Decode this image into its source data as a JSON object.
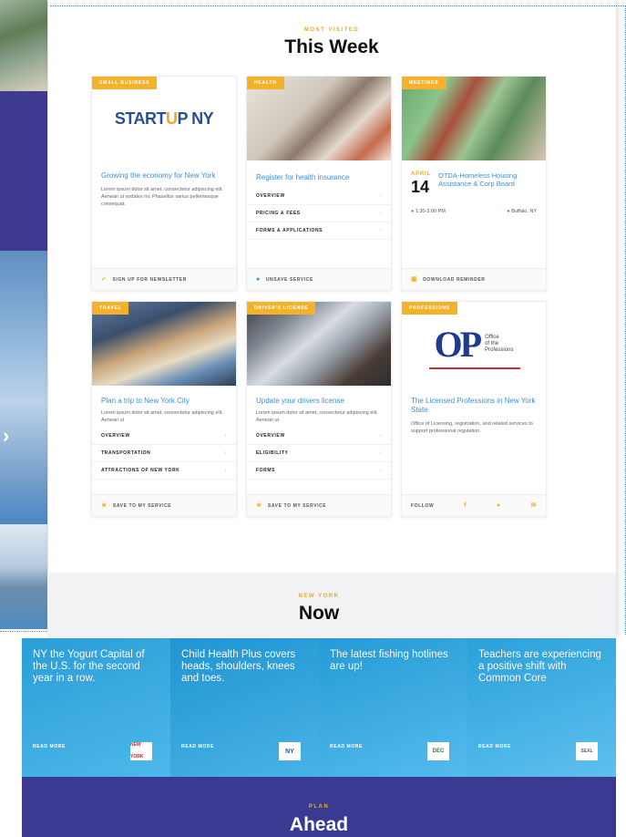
{
  "most_visited": {
    "kicker": "MOST VISITED",
    "title": "This Week",
    "cards": [
      {
        "badge": "SMALL BUSINESS",
        "logo_text_a": "START",
        "logo_text_u": "U",
        "logo_text_b": "P NY",
        "title": "Growing the economy for New York",
        "body": "Lorem ipsum dolor sit amet, consectetur adipiscing elit. Aenean ut sodales mi. Phasellus varius pellentesque consequat.",
        "footer": "SIGN UP FOR NEWSLETTER"
      },
      {
        "badge": "HEALTH",
        "title": "Register for health insurance",
        "links": [
          "OVERVIEW",
          "PRICING & FEES",
          "FORMS & APPLICATIONS"
        ],
        "footer": "UNSAVE SERVICE"
      },
      {
        "badge": "MEETINGS",
        "month": "APRIL",
        "day": "14",
        "title": "OTDA-Homeless Housing Assistance & Corp Board",
        "time": "1:30-3:00 PM",
        "location": "Buffalo, NY",
        "footer": "DOWNLOAD REMINDER"
      },
      {
        "badge": "TRAVEL",
        "title": "Plan a trip to New York City",
        "body": "Lorem ipsum dolor sit amet, consectetur adipiscing elit. Aenean ut",
        "links": [
          "OVERVIEW",
          "TRANSPORTATION",
          "ATTRACTIONS OF NEW YORK"
        ],
        "footer": "SAVE TO MY SERVICE"
      },
      {
        "badge": "DRIVER'S LICENSE",
        "title": "Update your drivers license",
        "body": "Lorem ipsum dolor sit amet, consectetur adipiscing elit. Aenean ut",
        "links": [
          "OVERVIEW",
          "ELIGIBILITY",
          "FORMS"
        ],
        "footer": "SAVE TO MY SERVICE"
      },
      {
        "badge": "PROFESSIONS",
        "logo_letters": "OP",
        "logo_line1": "Office",
        "logo_line2": "of the",
        "logo_line3": "Professions",
        "title": "The Licensed Professions in New York State",
        "body": "Office of Licensing, registration, and related services to support professional regulation.",
        "footer": "FOLLOW"
      }
    ]
  },
  "now": {
    "kicker": "NEW YORK",
    "title": "Now",
    "tiles": [
      {
        "text": "NY the Yogurt Capital of the U.S. for the second year in a row.",
        "read_more": "READ MORE",
        "logo": "NEW YORK"
      },
      {
        "text": "Child Health Plus covers heads, shoulders, knees and toes.",
        "read_more": "READ MORE",
        "logo": "NY"
      },
      {
        "text": "The latest fishing hotlines are up!",
        "read_more": "READ MORE",
        "logo": "DEC"
      },
      {
        "text": "Teachers are experiencing a positive shift with Common Core",
        "read_more": "READ MORE",
        "logo": "SEAL"
      }
    ]
  },
  "plan": {
    "kicker": "PLAN",
    "title": "Ahead"
  },
  "icons": {
    "carousel_next": "chevron-right-icon"
  }
}
